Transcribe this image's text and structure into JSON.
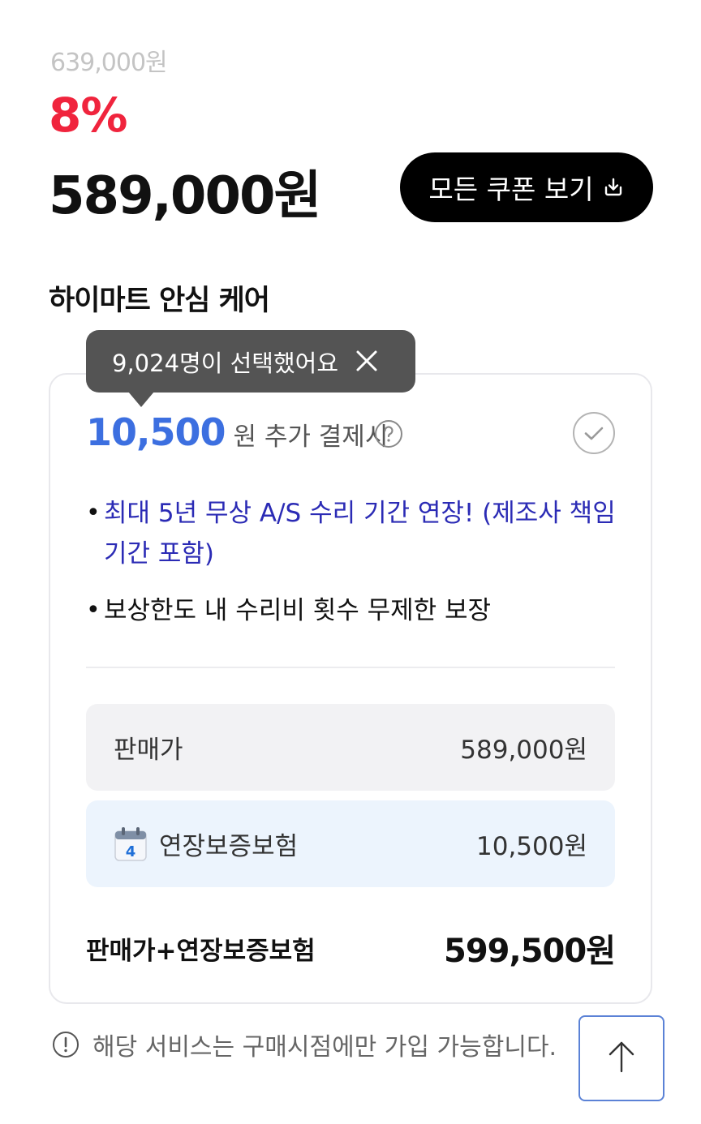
{
  "price": {
    "original": "639,000원",
    "discount": "8%",
    "sale": "589,000원"
  },
  "coupon_button": {
    "label": "모든 쿠폰 보기",
    "icon": "download-icon"
  },
  "care_section": {
    "title": "하이마트 안심 케어",
    "tooltip": "9,024명이 선택했어요",
    "addon_amount": "10,500",
    "addon_suffix": "원 추가 결제시",
    "bullets": [
      "최대 5년 무상 A/S 수리 기간 연장! (제조사 책임 기간 포함)",
      "보상한도 내 수리비 횟수 무제한 보장"
    ],
    "rows": [
      {
        "label": "판매가",
        "value": "589,000원"
      },
      {
        "label": "연장보증보험",
        "value": "10,500원",
        "icon": "calendar-icon",
        "icon_text": "4"
      }
    ],
    "total_label": "판매가+연장보증보험",
    "total_value": "599,500원"
  },
  "notice": "해당 서비스는 구매시점에만 가입 가능합니다.",
  "colors": {
    "discount": "#f0243d",
    "addon_amount": "#3c6fe0",
    "bullet_highlight": "#2b2bb5",
    "insurance_row_bg": "#ecf4fd",
    "tooltip_bg": "#545454"
  }
}
